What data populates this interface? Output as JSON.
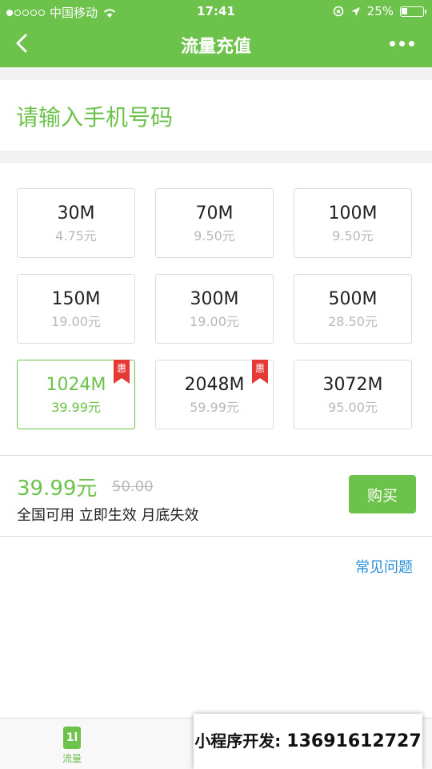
{
  "status_bar": {
    "carrier": "中国移动",
    "time": "17:41",
    "battery": "25%",
    "battery_level": 0.25
  },
  "nav": {
    "title": "流量充值",
    "back_icon": "chevron-left-icon",
    "more_icon": "more-dots-icon"
  },
  "phone": {
    "placeholder": "请输入手机号码"
  },
  "packages": [
    {
      "size": "30M",
      "price": "4.75元",
      "badge": ""
    },
    {
      "size": "70M",
      "price": "9.50元",
      "badge": ""
    },
    {
      "size": "100M",
      "price": "9.50元",
      "badge": ""
    },
    {
      "size": "150M",
      "price": "19.00元",
      "badge": ""
    },
    {
      "size": "300M",
      "price": "19.00元",
      "badge": ""
    },
    {
      "size": "500M",
      "price": "28.50元",
      "badge": ""
    },
    {
      "size": "1024M",
      "price": "39.99元",
      "badge": "惠",
      "selected": true
    },
    {
      "size": "2048M",
      "price": "59.99元",
      "badge": "惠"
    },
    {
      "size": "3072M",
      "price": "95.00元",
      "badge": ""
    }
  ],
  "summary": {
    "price": "39.99元",
    "original_price": "50.00",
    "description": "全国可用 立即生效 月底失效",
    "buy_label": "购买"
  },
  "faq_link": "常见问题",
  "tabbar": {
    "tabs": [
      {
        "label": "流量",
        "icon": "data-flow-icon",
        "active": true
      }
    ]
  },
  "watermark": {
    "label": "小程序开发:",
    "number": "13691612727"
  },
  "colors": {
    "accent": "#6cc24a",
    "badge": "#e53935",
    "link": "#2a8fd8"
  }
}
